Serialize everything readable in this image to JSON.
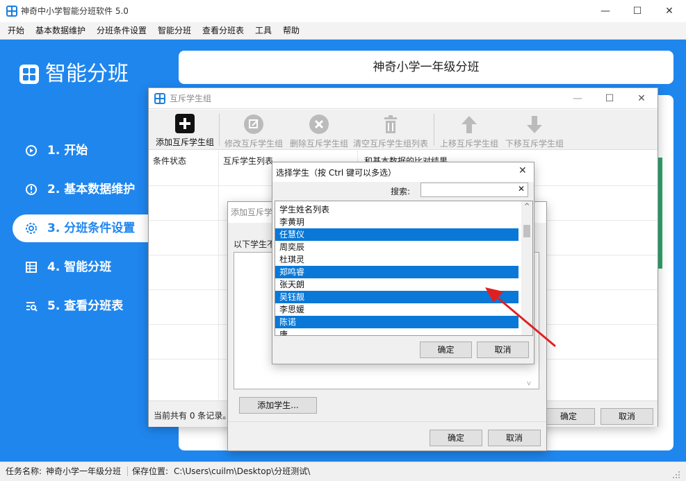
{
  "window": {
    "title": "神奇中小学智能分班软件 5.0",
    "min_glyph": "—",
    "max_glyph": "☐",
    "close_glyph": "✕"
  },
  "menu": [
    "开始",
    "基本数据维护",
    "分班条件设置",
    "智能分班",
    "查看分班表",
    "工具",
    "帮助"
  ],
  "sidebar": {
    "brand": "智能分班",
    "items": [
      {
        "label": "1. 开始",
        "icon": "play-circle-icon"
      },
      {
        "label": "2. 基本数据维护",
        "icon": "info-circle-icon"
      },
      {
        "label": "3. 分班条件设置",
        "icon": "gear-icon"
      },
      {
        "label": "4. 智能分班",
        "icon": "table-icon"
      },
      {
        "label": "5. 查看分班表",
        "icon": "search-list-icon"
      }
    ],
    "active_index": 2
  },
  "header": {
    "title": "神奇小学一年级分班"
  },
  "status": {
    "task_label": "任务名称:",
    "task_value": "神奇小学一年级分班",
    "save_label": "保存位置:",
    "save_value": "C:\\Users\\cuilm\\Desktop\\分班测试\\"
  },
  "mutex_dialog": {
    "title": "互斥学生组",
    "toolbar": [
      {
        "label": "添加互斥学生组",
        "icon": "plus-icon",
        "enabled": true
      },
      {
        "label": "修改互斥学生组",
        "icon": "edit-icon",
        "enabled": false
      },
      {
        "label": "删除互斥学生组",
        "icon": "delete-circle-icon",
        "enabled": false
      },
      {
        "label": "清空互斥学生组列表",
        "icon": "trash-icon",
        "enabled": false
      },
      {
        "label": "上移互斥学生组",
        "icon": "arrow-up-icon",
        "enabled": false
      },
      {
        "label": "下移互斥学生组",
        "icon": "arrow-down-icon",
        "enabled": false
      }
    ],
    "columns": [
      "条件状态",
      "互斥学生列表",
      "和基本数据的比对结果"
    ],
    "record_count": "当前共有 0 条记录。",
    "ok": "确定",
    "cancel": "取消"
  },
  "add_dialog": {
    "title": "添加互斥学生组",
    "hint": "以下学生不",
    "add_button": "添加学生...",
    "ok": "确定",
    "cancel": "取消"
  },
  "select_dialog": {
    "title": "选择学生（按 Ctrl 键可以多选）",
    "search_label": "搜索:",
    "search_value": "",
    "list_header": "学生姓名列表",
    "students": [
      {
        "name": "李黄玥",
        "selected": false
      },
      {
        "name": "任慧仪",
        "selected": true
      },
      {
        "name": "周奕辰",
        "selected": false
      },
      {
        "name": "杜琪灵",
        "selected": false
      },
      {
        "name": "郑鸣睿",
        "selected": true
      },
      {
        "name": "张天朗",
        "selected": false
      },
      {
        "name": "吴钰靓",
        "selected": true
      },
      {
        "name": "李思媛",
        "selected": false
      },
      {
        "name": "陈诺",
        "selected": true
      },
      {
        "name": "唐...",
        "selected": false
      }
    ],
    "ok": "确定",
    "cancel": "取消"
  },
  "colors": {
    "brand_blue": "#1f86ee",
    "selection_blue": "#0a78d7",
    "annotation_red": "#e02020"
  }
}
